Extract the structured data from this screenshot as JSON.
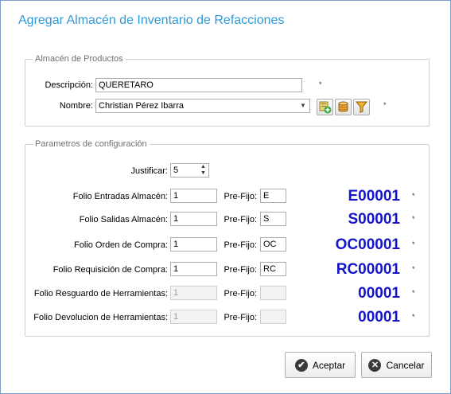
{
  "window": {
    "title": "Agregar Almacén de Inventario de Refacciones"
  },
  "almacen": {
    "legend": "Almacén de Productos",
    "descripcion_label": "Descripción:",
    "descripcion_value": "QUERETARO",
    "nombre_label": "Nombre:",
    "nombre_value": "Christian Pérez Ibarra",
    "required_mark": "*",
    "icons": [
      "add-icon",
      "database-icon",
      "filter-icon"
    ]
  },
  "config": {
    "legend": "Parametros de configuración",
    "justificar_label": "Justificar:",
    "justificar_value": "5",
    "prefijo_label": "Pre-Fijo:",
    "required_mark": "*",
    "rows": [
      {
        "label": "Folio Entradas Almacén:",
        "folio": "1",
        "prefijo": "E",
        "code": "E00001",
        "enabled": true
      },
      {
        "label": "Folio Salidas Almacén:",
        "folio": "1",
        "prefijo": "S",
        "code": "S00001",
        "enabled": true
      },
      {
        "label": "Folio Orden de Compra:",
        "folio": "1",
        "prefijo": "OC",
        "code": "OC00001",
        "enabled": true
      },
      {
        "label": "Folio Requisición de Compra:",
        "folio": "1",
        "prefijo": "RC",
        "code": "RC00001",
        "enabled": true
      },
      {
        "label": "Folio Resguardo de Herramientas:",
        "folio": "1",
        "prefijo": "",
        "code": "00001",
        "enabled": false
      },
      {
        "label": "Folio Devolucion de Herramientas:",
        "folio": "1",
        "prefijo": "",
        "code": "00001",
        "enabled": false
      }
    ]
  },
  "buttons": {
    "accept": "Aceptar",
    "cancel": "Cancelar"
  },
  "colors": {
    "title": "#2f9ad6",
    "code": "#1414cc"
  }
}
